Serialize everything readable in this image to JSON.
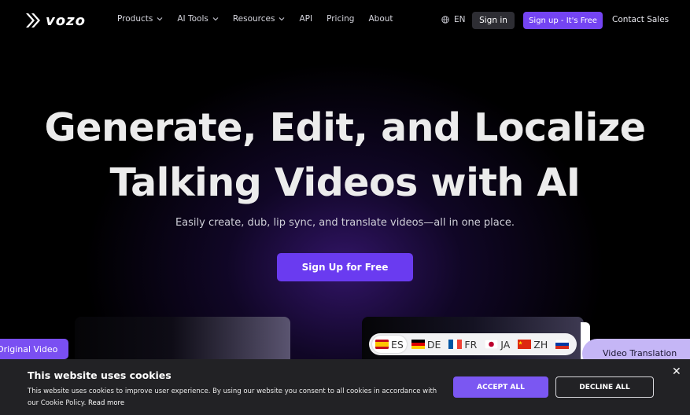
{
  "brand": {
    "name": "vozo",
    "accent": "#7444f2"
  },
  "nav": {
    "items": [
      {
        "label": "Products",
        "dropdown": true
      },
      {
        "label": "AI Tools",
        "dropdown": true
      },
      {
        "label": "Resources",
        "dropdown": true
      },
      {
        "label": "API",
        "dropdown": false
      },
      {
        "label": "Pricing",
        "dropdown": false
      },
      {
        "label": "About",
        "dropdown": false
      }
    ],
    "language": "EN",
    "signin_label": "Sign in",
    "signup_label": "Sign up - It's Free",
    "contact_label": "Contact Sales"
  },
  "hero": {
    "title_line1": "Generate, Edit, and Localize",
    "title_line2": "Talking Videos with AI",
    "subtitle": "Easily create, dub, lip sync, and translate videos—all in one place.",
    "cta_label": "Sign Up for Free"
  },
  "preview": {
    "original_tag": "Original Video",
    "translation_tag": "Video Translation",
    "languages": [
      {
        "code": "ES",
        "flag": "spain-flag-icon",
        "active": true
      },
      {
        "code": "DE",
        "flag": "germany-flag-icon",
        "active": false
      },
      {
        "code": "FR",
        "flag": "france-flag-icon",
        "active": false
      },
      {
        "code": "JA",
        "flag": "japan-flag-icon",
        "active": false
      },
      {
        "code": "ZH",
        "flag": "china-flag-icon",
        "active": false
      },
      {
        "code": "",
        "flag": "russia-flag-icon",
        "active": false
      }
    ]
  },
  "cookie": {
    "title": "This website uses cookies",
    "text": "This website uses cookies to improve user experience. By using our website you consent to all cookies in accordance with our Cookie Policy.",
    "read_more": "Read more",
    "accept_label": "ACCEPT ALL",
    "decline_label": "DECLINE ALL",
    "close_glyph": "✕"
  }
}
